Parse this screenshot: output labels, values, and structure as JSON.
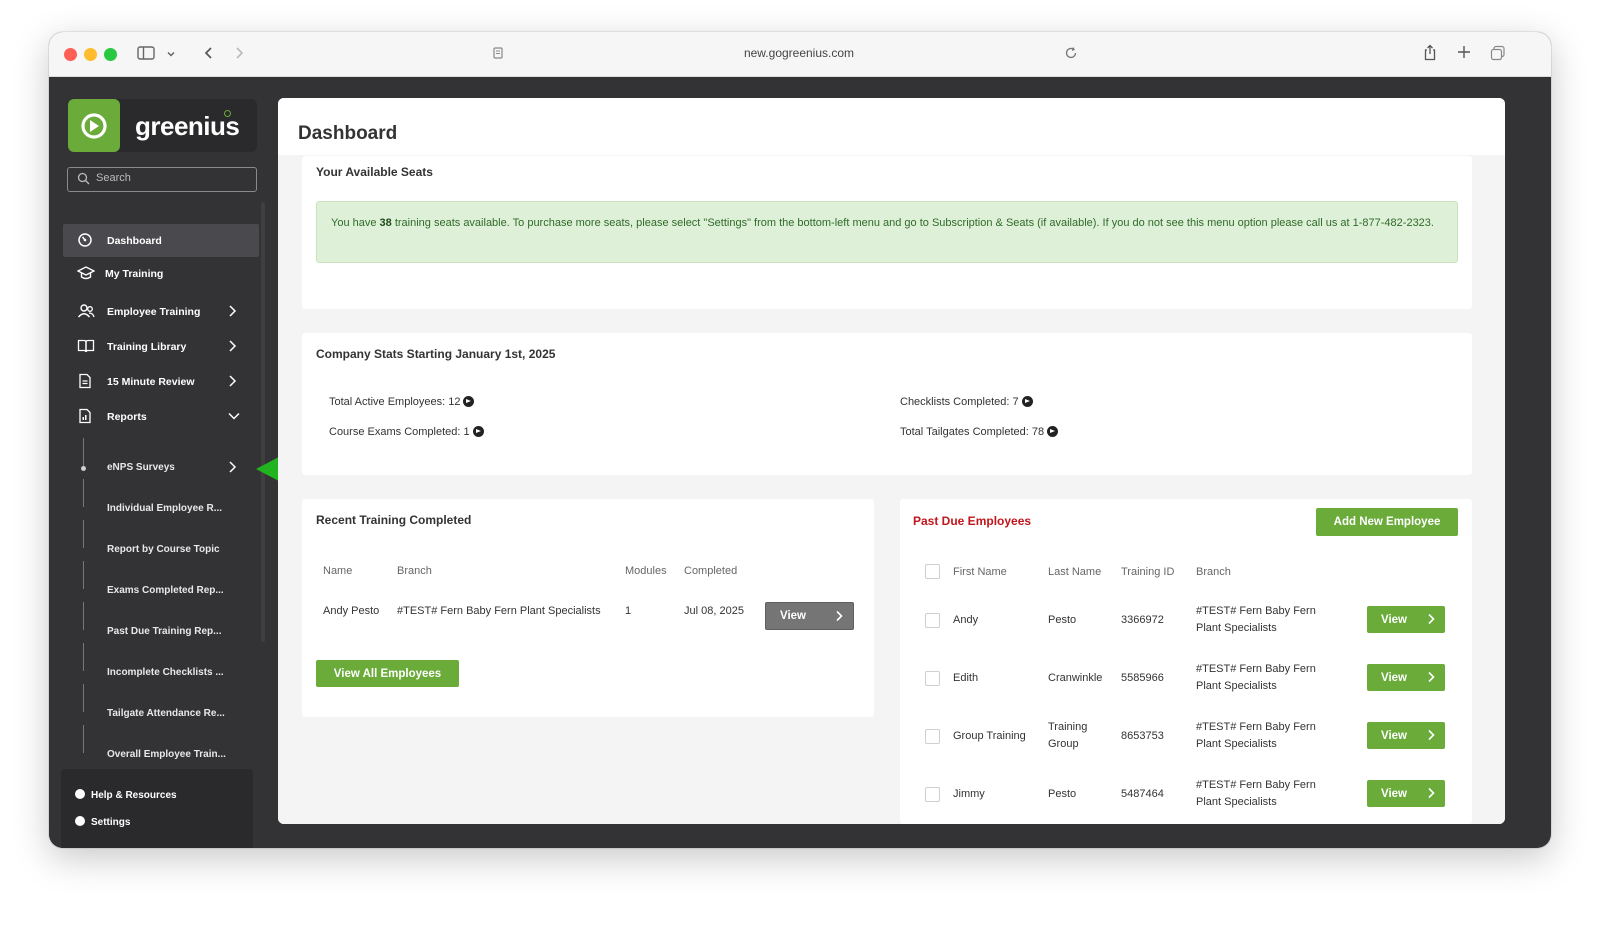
{
  "browser": {
    "url": "new.gogreenius.com"
  },
  "sidebar": {
    "logo_text": "greenius",
    "search_placeholder": "Search",
    "nav": [
      {
        "label": "Dashboard",
        "icon": "dashboard-icon"
      },
      {
        "label": "My Training",
        "icon": "graduation-cap-icon"
      },
      {
        "label": "Employee Training",
        "icon": "users-icon"
      },
      {
        "label": "Training Library",
        "icon": "book-icon"
      },
      {
        "label": "15 Minute Review",
        "icon": "document-icon"
      },
      {
        "label": "Reports",
        "icon": "report-icon"
      }
    ],
    "reports_sub": [
      {
        "label": "eNPS Surveys"
      },
      {
        "label": "Individual Employee R..."
      },
      {
        "label": "Report by Course Topic"
      },
      {
        "label": "Exams Completed Rep..."
      },
      {
        "label": "Past Due Training Rep..."
      },
      {
        "label": "Incomplete Checklists ..."
      },
      {
        "label": "Tailgate Attendance Re..."
      },
      {
        "label": "Overall Employee Train..."
      }
    ],
    "bottom": [
      {
        "label": "Help & Resources",
        "icon": "help-icon"
      },
      {
        "label": "Settings",
        "icon": "gear-icon"
      }
    ]
  },
  "dashboard": {
    "title": "Dashboard",
    "seats": {
      "title": "Your Available Seats",
      "alert_prefix": "You have ",
      "seat_count": "38",
      "alert_suffix": " training seats available. To purchase more seats, please select \"Settings\" from the bottom-left menu and go to Subscription & Seats (if available). If you do not see this menu option please call us at 1-877-482-2323."
    },
    "stats": {
      "title": "Company Stats Starting January 1st, 2025",
      "items": [
        {
          "label": "Total Active Employees: 12"
        },
        {
          "label": "Checklists Completed: 7"
        },
        {
          "label": "Course Exams Completed: 1"
        },
        {
          "label": "Total Tailgates Completed: 78"
        }
      ]
    },
    "recent": {
      "title": "Recent Training Completed",
      "columns": [
        "Name",
        "Branch",
        "Modules",
        "Completed"
      ],
      "rows": [
        {
          "name": "Andy Pesto",
          "branch": "#TEST# Fern Baby Fern Plant Specialists",
          "modules": "1",
          "completed": "Jul 08, 2025",
          "action": "View"
        }
      ],
      "view_all_label": "View All Employees"
    },
    "past_due": {
      "title": "Past Due Employees",
      "add_label": "Add New Employee",
      "columns": [
        "First Name",
        "Last Name",
        "Training ID",
        "Branch"
      ],
      "rows": [
        {
          "first": "Andy",
          "last": "Pesto",
          "id": "3366972",
          "branch": "#TEST# Fern Baby Fern Plant Specialists",
          "action": "View"
        },
        {
          "first": "Edith",
          "last": "Cranwinkle",
          "id": "5585966",
          "branch": "#TEST# Fern Baby Fern Plant Specialists",
          "action": "View"
        },
        {
          "first": "Group Training",
          "last": "Training Group",
          "id": "8653753",
          "branch": "#TEST# Fern Baby Fern Plant Specialists",
          "action": "View"
        },
        {
          "first": "Jimmy",
          "last": "Pesto",
          "id": "5487464",
          "branch": "#TEST# Fern Baby Fern Plant Specialists",
          "action": "View"
        }
      ]
    }
  },
  "colors": {
    "brand_green": "#6aab3a",
    "sidebar_bg": "#333336",
    "past_due_red": "#c0161c",
    "arrow_green": "#22b41e"
  }
}
